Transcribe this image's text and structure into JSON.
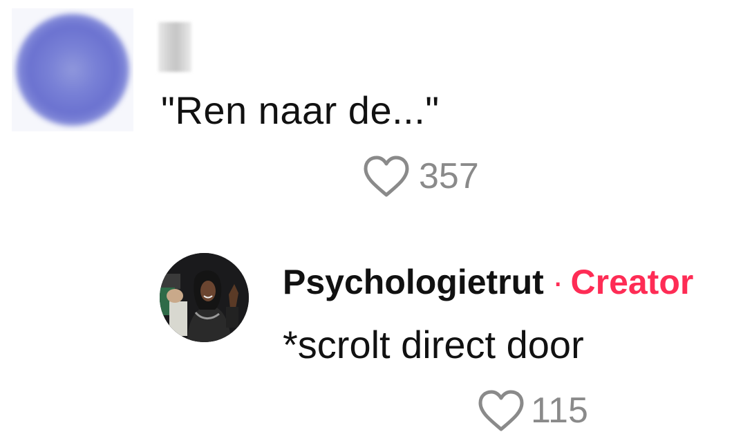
{
  "comment": {
    "text": "\"Ren naar de...\"",
    "likes": "357"
  },
  "reply": {
    "author": "Psychologietrut",
    "separator": "·",
    "badge": "Creator",
    "text": "*scrolt direct door",
    "likes": "115"
  },
  "colors": {
    "creator_badge": "#fe2c55",
    "like_gray": "#8a8a8a",
    "text": "#111111"
  },
  "icons": {
    "like": "heart-outline-icon"
  }
}
